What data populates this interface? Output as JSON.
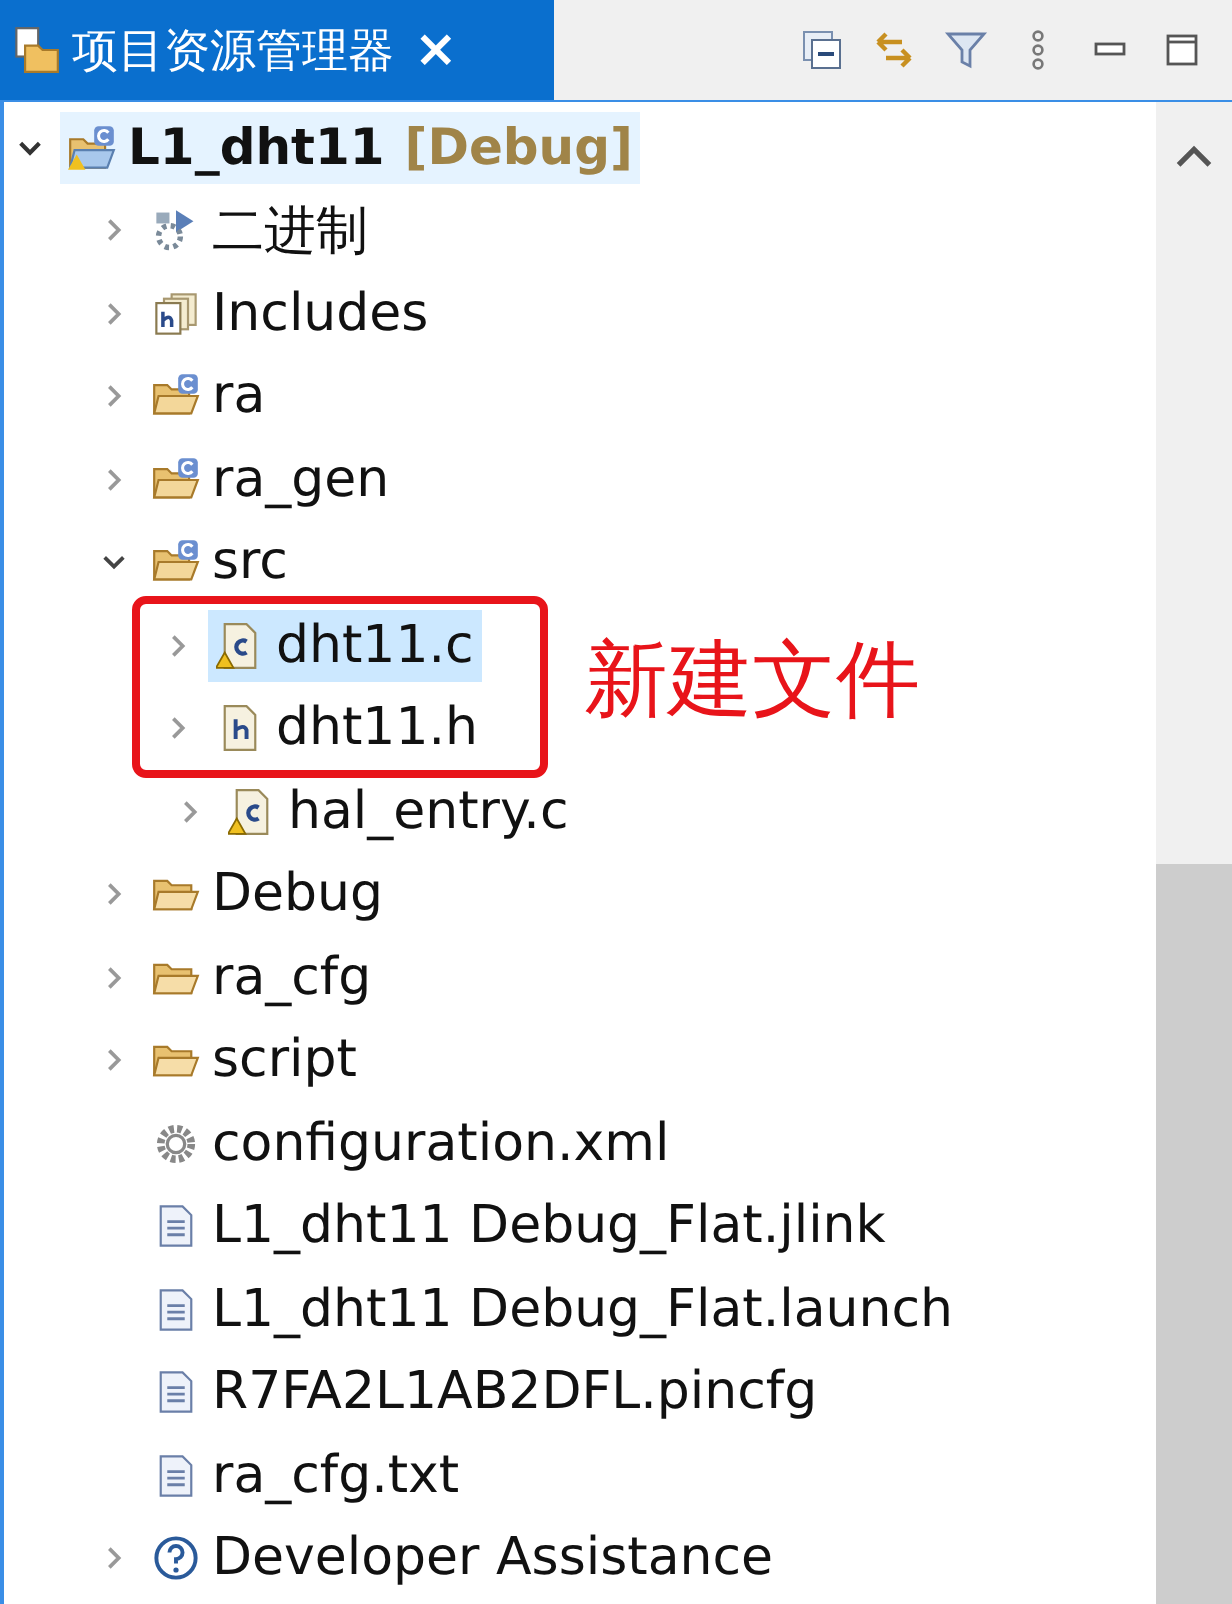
{
  "tab": {
    "title": "项目资源管理器",
    "close": "×"
  },
  "project": {
    "name": "L1_dht11",
    "config": "[Debug]",
    "expanded": true,
    "focused": true,
    "children": [
      {
        "label": "二进制",
        "kind": "binaries",
        "expandable": true,
        "expanded": false,
        "selected": false,
        "highlighted": false
      },
      {
        "label": "Includes",
        "kind": "includes",
        "expandable": true,
        "expanded": false,
        "selected": false,
        "highlighted": false
      },
      {
        "label": "ra",
        "kind": "source-folder",
        "expandable": true,
        "expanded": false,
        "selected": false,
        "highlighted": false
      },
      {
        "label": "ra_gen",
        "kind": "source-folder",
        "expandable": true,
        "expanded": false,
        "selected": false,
        "highlighted": false
      },
      {
        "label": "src",
        "kind": "source-folder",
        "expandable": true,
        "expanded": true,
        "selected": false,
        "highlighted": false,
        "children": [
          {
            "label": "dht11.c",
            "kind": "c-file",
            "expandable": true,
            "expanded": false,
            "selected": true,
            "highlighted": true
          },
          {
            "label": "dht11.h",
            "kind": "h-file",
            "expandable": true,
            "expanded": false,
            "selected": false,
            "highlighted": true
          },
          {
            "label": "hal_entry.c",
            "kind": "c-file",
            "expandable": true,
            "expanded": false,
            "selected": false,
            "highlighted": false
          }
        ]
      },
      {
        "label": "Debug",
        "kind": "folder",
        "expandable": true,
        "expanded": false,
        "selected": false,
        "highlighted": false
      },
      {
        "label": "ra_cfg",
        "kind": "folder",
        "expandable": true,
        "expanded": false,
        "selected": false,
        "highlighted": false
      },
      {
        "label": "script",
        "kind": "folder",
        "expandable": true,
        "expanded": false,
        "selected": false,
        "highlighted": false
      },
      {
        "label": "configuration.xml",
        "kind": "gear",
        "expandable": false,
        "selected": false,
        "highlighted": false
      },
      {
        "label": "L1_dht11 Debug_Flat.jlink",
        "kind": "file",
        "expandable": false,
        "selected": false,
        "highlighted": false
      },
      {
        "label": "L1_dht11 Debug_Flat.launch",
        "kind": "file",
        "expandable": false,
        "selected": false,
        "highlighted": false
      },
      {
        "label": "R7FA2L1AB2DFL.pincfg",
        "kind": "file",
        "expandable": false,
        "selected": false,
        "highlighted": false
      },
      {
        "label": "ra_cfg.txt",
        "kind": "file",
        "expandable": false,
        "selected": false,
        "highlighted": false
      },
      {
        "label": "Developer Assistance",
        "kind": "help",
        "expandable": true,
        "expanded": false,
        "selected": false,
        "highlighted": false
      }
    ]
  },
  "callout": "新建文件"
}
